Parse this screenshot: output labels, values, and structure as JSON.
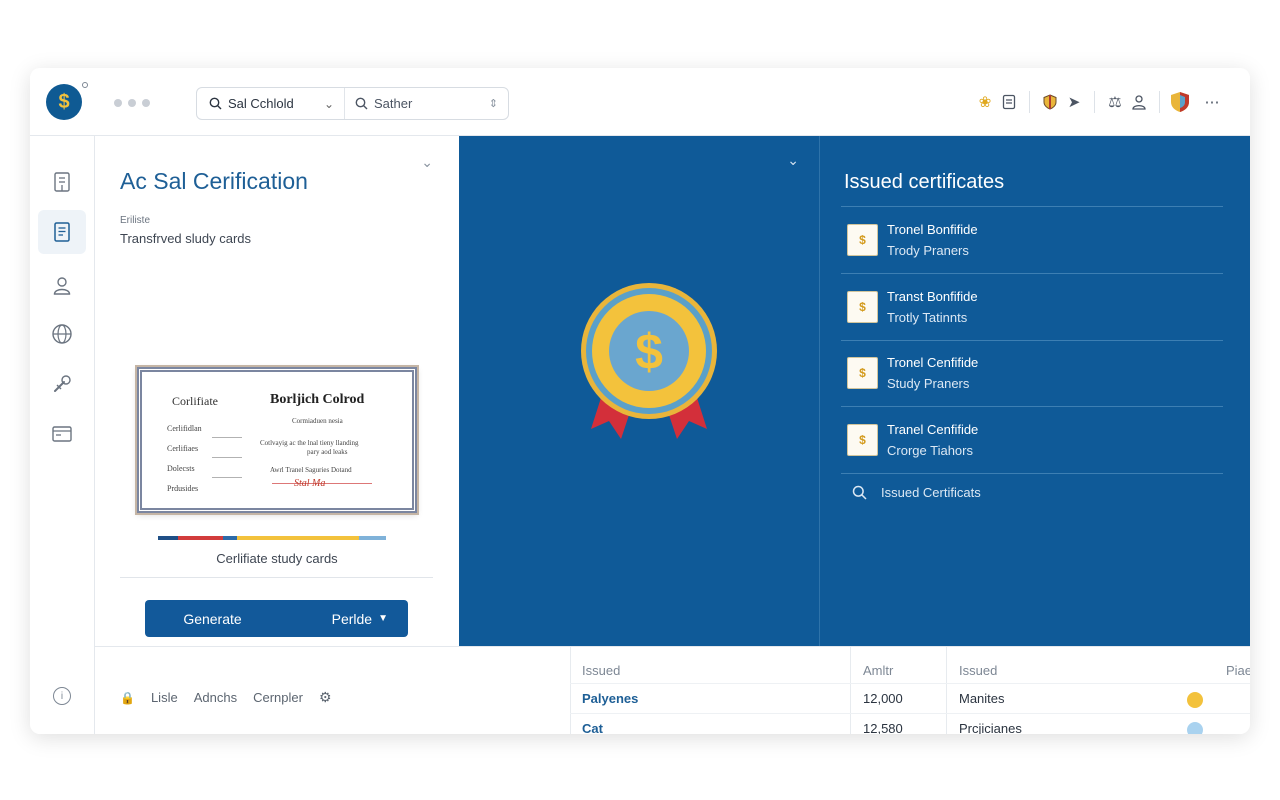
{
  "topbar": {
    "logo_glyph": "$",
    "project_selector": "Sal Cchlold",
    "search_placeholder": "Sather"
  },
  "config": {
    "title": "Ac Sal Cerification",
    "subtitle_small": "Eriliste",
    "subtitle": "Transfrved sludy cards",
    "certificate": {
      "title": "Corlifiate",
      "heading": "Borljich Colrod",
      "rows": [
        "Cerlifidlan",
        "Cerlifiaes",
        "Dolecsts",
        "Prdusides"
      ],
      "body_top": "Cormiaduen nesia",
      "body_line1": "Cotlvayig ac the lnal tieny llanding",
      "body_line2": "pary aod leaks",
      "body_line3": "Awrl Tranel Saguries Dotand",
      "signature": "Stal Ma"
    },
    "caption": "Cerlifiate study cards",
    "generate_label": "Generate",
    "split_label": "Perlde"
  },
  "issued": {
    "title": "Issued certificates",
    "items": [
      {
        "line1": "Tronel Bonfifide",
        "line2": "Trody Praners"
      },
      {
        "line1": "Transt Bonfifide",
        "line2": "Trotly Tatinnts"
      },
      {
        "line1": "Tronel Cenfifide",
        "line2": "Study Praners"
      },
      {
        "line1": "Tranel Cenfifide",
        "line2": "Crorge Tiahors"
      }
    ],
    "link_label": "Issued Certificats"
  },
  "footer": {
    "links": [
      "Lisle",
      "Adnchs",
      "Cernpler"
    ]
  },
  "grid": {
    "headers": [
      "Issued",
      "Amltr",
      "Issued",
      "Piae"
    ],
    "rows": [
      {
        "name": "Palyenes",
        "amount": "12,000",
        "status": "Manites",
        "dot_color": "#f3c23c"
      },
      {
        "name": "Cat",
        "amount": "12,580",
        "status": "Prcjicianes",
        "dot_color": "#a9d2ef"
      }
    ]
  },
  "colors": {
    "brand": "#0f5a98",
    "accent_gold": "#f3c23c",
    "ribbon": "#d32f3a",
    "seal_inner": "#5aa0c9"
  }
}
